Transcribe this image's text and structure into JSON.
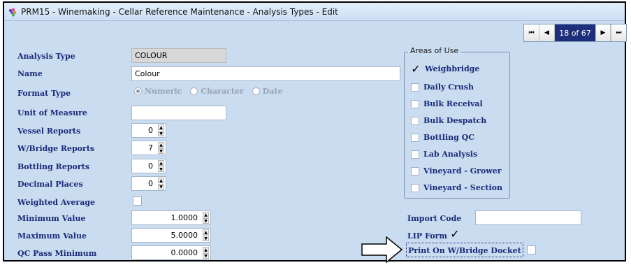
{
  "window": {
    "title": "PRM15 - Winemaking - Cellar Reference Maintenance - Analysis Types - Edit"
  },
  "nav": {
    "first": "⏮",
    "prev": "◀",
    "position": "18 of 67",
    "next": "▶",
    "last": "⏭"
  },
  "form": {
    "analysis_type": {
      "label": "Analysis Type",
      "value": "COLOUR"
    },
    "name": {
      "label": "Name",
      "value": "Colour"
    },
    "format_type": {
      "label": "Format Type",
      "options": [
        "Numeric",
        "Character",
        "Date"
      ],
      "selected": "Numeric"
    },
    "unit_of_measure": {
      "label": "Unit of Measure",
      "value": ""
    },
    "vessel_reports": {
      "label": "Vessel Reports",
      "value": "0"
    },
    "wbridge_reports": {
      "label": "W/Bridge Reports",
      "value": "7"
    },
    "bottling_reports": {
      "label": "Bottling Reports",
      "value": "0"
    },
    "decimal_places": {
      "label": "Decimal Places",
      "value": "0"
    },
    "weighted_average": {
      "label": "Weighted Average",
      "checked": false
    },
    "minimum_value": {
      "label": "Minimum Value",
      "value": "1.0000"
    },
    "maximum_value": {
      "label": "Maximum Value",
      "value": "5.0000"
    },
    "qc_pass_minimum": {
      "label": "QC Pass Minimum",
      "value": "0.0000"
    }
  },
  "areas_of_use": {
    "legend": "Areas of Use",
    "items": [
      {
        "label": "Weighbridge",
        "checked": true
      },
      {
        "label": "Daily Crush",
        "checked": false
      },
      {
        "label": "Bulk Receival",
        "checked": false
      },
      {
        "label": "Bulk Despatch",
        "checked": false
      },
      {
        "label": "Bottling QC",
        "checked": false
      },
      {
        "label": "Lab Analysis",
        "checked": false
      },
      {
        "label": "Vineyard - Grower",
        "checked": false
      },
      {
        "label": "Vineyard - Section",
        "checked": false
      }
    ]
  },
  "right": {
    "import_code": {
      "label": "Import Code",
      "value": ""
    },
    "lip_form": {
      "label": "LIP Form",
      "checked": true
    },
    "print_docket": {
      "label": "Print On W/Bridge Docket",
      "checked": false
    }
  },
  "glyphs": {
    "check": "✓",
    "spin_up": "▲",
    "spin_down": "▼"
  },
  "colors": {
    "background": "#c9dcf0",
    "label": "#1a2a78",
    "nav_position": "#1d2f7a"
  }
}
